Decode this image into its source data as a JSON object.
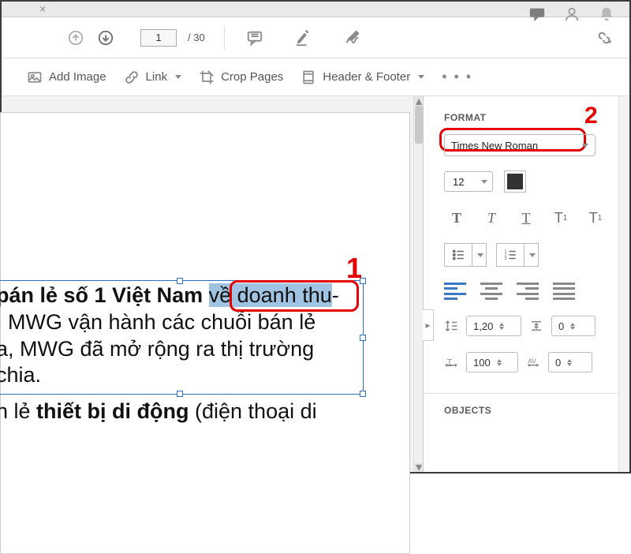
{
  "tab": {
    "x_label": "×"
  },
  "titlebar": {
    "comments_name": "comments",
    "signin_name": "signin",
    "notif_name": "notifications"
  },
  "toolbar1": {
    "page_current": "1",
    "page_sep": "/",
    "page_total": "30"
  },
  "toolbar2": {
    "add_image": "Add Image",
    "link": "Link",
    "crop": "Crop Pages",
    "header_footer": "Header & Footer",
    "more": "• • •"
  },
  "doc": {
    "para1_line1_pre": "pán lẻ số 1 Việt Nam ",
    "para1_line1_sel": "về doanh thu",
    "para1_line1_post": "-",
    "para1_line2": ". MWG vận hành các chuỗi bán lẻ",
    "para1_line3": "a, MWG đã mở rộng ra thị trường",
    "para1_line4": "chia.",
    "para2_line1_a": "n lẻ ",
    "para2_line1_b": "thiết bị di động",
    "para2_line1_c": " (điện thoại di"
  },
  "annotations": {
    "label1": "1",
    "label2": "2"
  },
  "sidebar": {
    "format_title": "FORMAT",
    "font": "Times New Roman",
    "size": "12",
    "bold": "T",
    "italic": "T",
    "underline": "T",
    "superscript": "T",
    "subscript": "T",
    "line_spacing": "1,20",
    "para_spacing": "0",
    "h_scale": "100",
    "char_spacing": "0",
    "objects_title": "OBJECTS"
  }
}
